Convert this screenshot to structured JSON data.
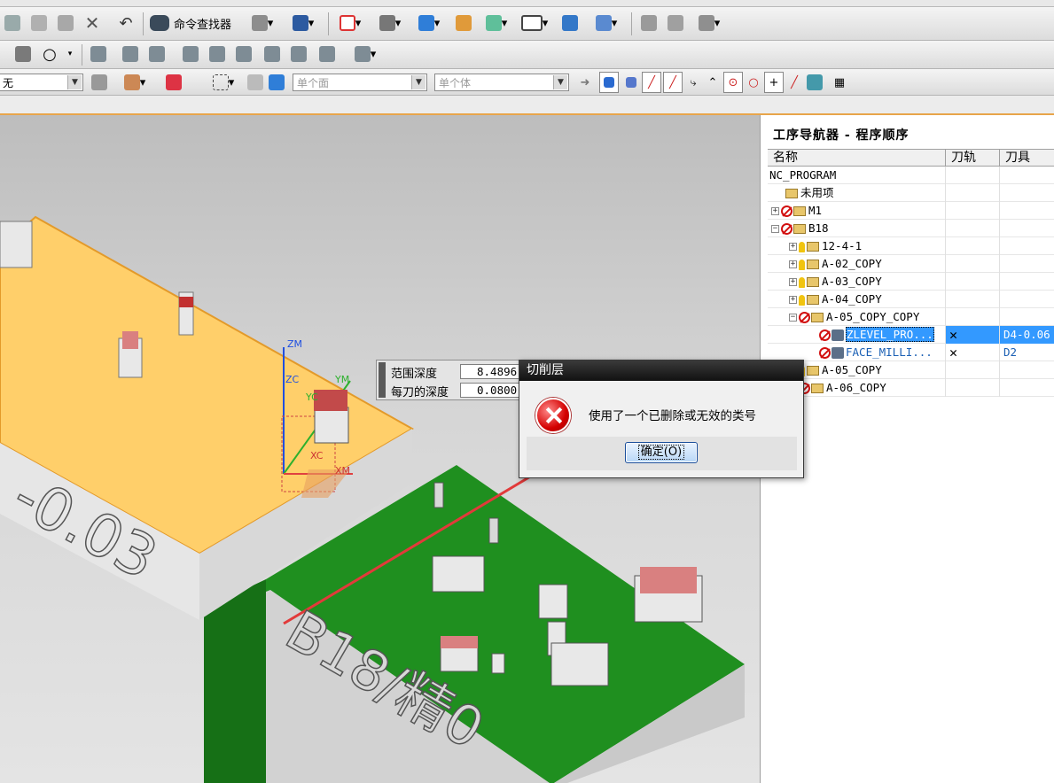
{
  "toolbar": {
    "command_finder_label": "命令查找器",
    "filter_dropdown_1": "单个面",
    "filter_dropdown_2": "单个体",
    "type_filter_label": "无"
  },
  "navigator": {
    "title": "工序导航器 - 程序顺序",
    "columns": [
      "名称",
      "刀轨",
      "刀具"
    ],
    "rows": [
      {
        "name": "NC_PROGRAM",
        "path": "",
        "tool": ""
      },
      {
        "name": "未用项",
        "path": "",
        "tool": ""
      },
      {
        "name": "M1",
        "path": "",
        "tool": ""
      },
      {
        "name": "B18",
        "path": "",
        "tool": ""
      },
      {
        "name": "12-4-1",
        "path": "",
        "tool": ""
      },
      {
        "name": "A-02_COPY",
        "path": "",
        "tool": ""
      },
      {
        "name": "A-03_COPY",
        "path": "",
        "tool": ""
      },
      {
        "name": "A-04_COPY",
        "path": "",
        "tool": ""
      },
      {
        "name": "A-05_COPY_COPY",
        "path": "",
        "tool": ""
      },
      {
        "name": "ZLEVEL_PRO...",
        "path": "✕",
        "tool": "D4-0.06"
      },
      {
        "name": "FACE_MILLI...",
        "path": "✕",
        "tool": "D2"
      },
      {
        "name": "A-05_COPY",
        "path": "",
        "tool": ""
      },
      {
        "name": "A-06_COPY",
        "path": "",
        "tool": ""
      }
    ]
  },
  "params": {
    "range_depth_label": "范围深度",
    "range_depth_value": "8.4896",
    "depth_per_cut_label": "每刀的深度",
    "depth_per_cut_value": "0.0800"
  },
  "dialog": {
    "title": "切削层",
    "message": "使用了一个已删除或无效的类号",
    "ok_label": "确定(O)"
  },
  "viewport": {
    "part_text_1": "-0.03",
    "part_text_2": "B18/精0",
    "axes": {
      "zm": "ZM",
      "zc": "ZC",
      "yc": "YC",
      "ym": "YM",
      "xc": "XC",
      "xm": "XM"
    }
  },
  "colors": {
    "part_top": "#ffcf6a",
    "board": "#1f8f1f",
    "arrow": "#e23a3a",
    "selection": "#3399ff"
  }
}
